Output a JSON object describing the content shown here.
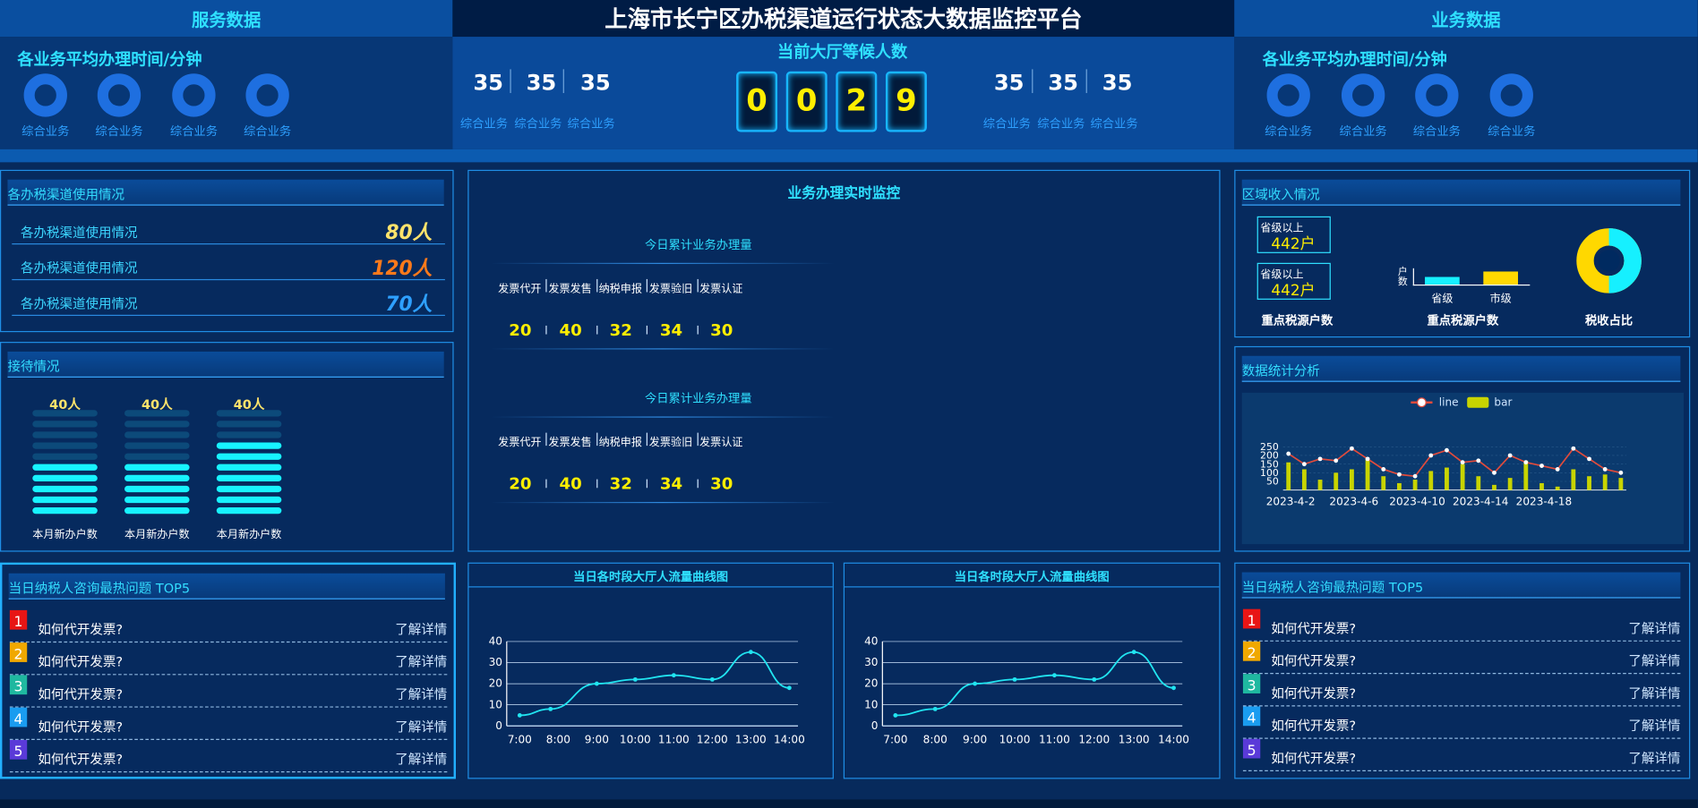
{
  "header": {
    "left_title": "服务数据",
    "center_title": "上海市长宁区办税渠道运行状态大数据监控平台",
    "right_title": "业务数据"
  },
  "left_top": {
    "label": "各业务平均办理时间/分钟",
    "rings": [
      "综合业务",
      "综合业务",
      "综合业务",
      "综合业务"
    ]
  },
  "right_top": {
    "label": "各业务平均办理时间/分钟",
    "rings": [
      "综合业务",
      "综合业务",
      "综合业务",
      "综合业务"
    ]
  },
  "center_top": {
    "waiting_title": "当前大厅等候人数",
    "digits": [
      "0",
      "0",
      "2",
      "9"
    ],
    "left_nums": [
      "35",
      "35",
      "35"
    ],
    "left_labels": [
      "综合业务",
      "综合业务",
      "综合业务"
    ],
    "right_nums": [
      "35",
      "35",
      "35"
    ],
    "right_labels": [
      "综合业务",
      "综合业务",
      "综合业务"
    ]
  },
  "channel_usage": {
    "title": "各办税渠道使用情况",
    "rows": [
      {
        "label": "各办税渠道使用情况",
        "value": "80人",
        "color": "#ffe36b"
      },
      {
        "label": "各办税渠道使用情况",
        "value": "120人",
        "color": "#ff7a1a"
      },
      {
        "label": "各办税渠道使用情况",
        "value": "70人",
        "color": "#2ea0ff"
      }
    ]
  },
  "reception": {
    "title": "接待情况",
    "columns": [
      {
        "value": "40人",
        "label": "本月新办户数",
        "on": 5
      },
      {
        "value": "40人",
        "label": "本月新办户数",
        "on": 5
      },
      {
        "value": "40人",
        "label": "本月新办户数",
        "on": 7
      }
    ]
  },
  "realtime": {
    "title": "业务办理实时监控",
    "blocks": [
      {
        "subtitle": "今日累计业务办理量",
        "cats": [
          "发票代开",
          "发票发售",
          "纳税申报",
          "发票验旧",
          "发票认证"
        ],
        "vals": [
          "20",
          "40",
          "32",
          "34",
          "30"
        ]
      },
      {
        "subtitle": "今日累计业务办理量",
        "cats": [
          "发票代开",
          "发票发售",
          "纳税申报",
          "发票验旧",
          "发票认证"
        ],
        "vals": [
          "20",
          "40",
          "32",
          "34",
          "30"
        ]
      }
    ],
    "pie_labels": [
      "发票代开",
      "发票发售",
      "纳税申报",
      "发票验旧",
      "发票认证"
    ],
    "pie_colors": [
      "#1aa8ff",
      "#f07a2a",
      "#8fb53a",
      "#f5c000",
      "#2f8ae0"
    ]
  },
  "region_income": {
    "title": "区域收入情况",
    "boxes": [
      {
        "label": "省级以上",
        "value": "442户"
      },
      {
        "label": "省级以上",
        "value": "442户"
      }
    ],
    "box_caption": "重点税源户数",
    "bar_caption": "重点税源户数",
    "bar_axis_label": "户数",
    "bar_cats": [
      "省级",
      "市级"
    ],
    "donut_caption": "税收占比"
  },
  "stats": {
    "title": "数据统计分析",
    "legend": [
      "line",
      "bar"
    ],
    "x_labels": [
      "2023-4-2",
      "2023-4-6",
      "2023-4-10",
      "2023-4-14",
      "2023-4-18"
    ],
    "y_ticks": [
      "250",
      "200",
      "150",
      "100",
      "50"
    ]
  },
  "top5_left": {
    "title": "当日纳税人咨询最热问题 TOP5",
    "items": [
      {
        "rank": "1",
        "q": "如何代开发票?",
        "link": "了解详情",
        "color": "#e81515"
      },
      {
        "rank": "2",
        "q": "如何代开发票?",
        "link": "了解详情",
        "color": "#f0a800"
      },
      {
        "rank": "3",
        "q": "如何代开发票?",
        "link": "了解详情",
        "color": "#1fb8a0"
      },
      {
        "rank": "4",
        "q": "如何代开发票?",
        "link": "了解详情",
        "color": "#1a9cf0"
      },
      {
        "rank": "5",
        "q": "如何代开发票?",
        "link": "了解详情",
        "color": "#5a3ad8"
      }
    ]
  },
  "top5_right": {
    "title": "当日纳税人咨询最热问题 TOP5",
    "items": [
      {
        "rank": "1",
        "q": "如何代开发票?",
        "link": "了解详情",
        "color": "#e81515"
      },
      {
        "rank": "2",
        "q": "如何代开发票?",
        "link": "了解详情",
        "color": "#f0a800"
      },
      {
        "rank": "3",
        "q": "如何代开发票?",
        "link": "了解详情",
        "color": "#1fb8a0"
      },
      {
        "rank": "4",
        "q": "如何代开发票?",
        "link": "了解详情",
        "color": "#1a9cf0"
      },
      {
        "rank": "5",
        "q": "如何代开发票?",
        "link": "了解详情",
        "color": "#5a3ad8"
      }
    ]
  },
  "flow_left": {
    "title": "当日各时段大厅人流量曲线图"
  },
  "flow_right": {
    "title": "当日各时段大厅人流量曲线图"
  },
  "chart_data": [
    {
      "type": "line",
      "title": "当日各时段大厅人流量曲线图",
      "x": [
        "7:00",
        "8:00",
        "9:00",
        "10:00",
        "11:00",
        "12:00",
        "13:00",
        "14:00"
      ],
      "x_pos": [
        0,
        1,
        2,
        3,
        4,
        5,
        6,
        7
      ],
      "points": [
        [
          0,
          5
        ],
        [
          0.8,
          8
        ],
        [
          2,
          20
        ],
        [
          3,
          22
        ],
        [
          4,
          24
        ],
        [
          5,
          22
        ],
        [
          6,
          35
        ],
        [
          7,
          18
        ]
      ],
      "yticks": [
        0,
        10,
        20,
        30,
        40
      ],
      "ylim": [
        0,
        40
      ]
    },
    {
      "type": "line",
      "title": "当日各时段大厅人流量曲线图",
      "x": [
        "7:00",
        "8:00",
        "9:00",
        "10:00",
        "11:00",
        "12:00",
        "13:00",
        "14:00"
      ],
      "points": [
        [
          0,
          5
        ],
        [
          1,
          8
        ],
        [
          2,
          20
        ],
        [
          3,
          22
        ],
        [
          4,
          24
        ],
        [
          5,
          22
        ],
        [
          6,
          35
        ],
        [
          7,
          18
        ]
      ],
      "yticks": [
        0,
        10,
        20,
        30,
        40
      ],
      "ylim": [
        0,
        40
      ]
    },
    {
      "type": "bar+line",
      "title": "数据统计分析",
      "series": [
        {
          "name": "line",
          "values": [
            210,
            150,
            180,
            170,
            240,
            180,
            120,
            90,
            80,
            200,
            230,
            160,
            170,
            100,
            200,
            160,
            140,
            120,
            240,
            180,
            120,
            100
          ]
        },
        {
          "name": "bar",
          "values": [
            160,
            120,
            60,
            100,
            120,
            180,
            80,
            40,
            60,
            110,
            130,
            150,
            80,
            30,
            70,
            170,
            40,
            20,
            120,
            80,
            90,
            70
          ]
        }
      ],
      "ylim": [
        0,
        250
      ]
    }
  ]
}
